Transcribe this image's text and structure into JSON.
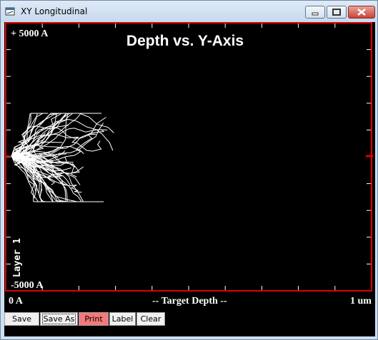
{
  "window": {
    "title": "XY Longitudinal",
    "icon": "app-window-icon",
    "controls": [
      "minimize-icon",
      "maximize-icon",
      "close-icon"
    ],
    "close_color": "#c94436"
  },
  "plot": {
    "title": "Depth vs. Y-Axis",
    "y_top_label": "+ 5000 A",
    "y_bottom_label": "-5000 A",
    "layer_label": "Layer 1",
    "frame_color": "#e00000",
    "trace_color": "#ffffff",
    "background": "#000000"
  },
  "status": {
    "left": "0 A",
    "center": "-- Target Depth --",
    "right": "1 um"
  },
  "toolbar": {
    "save": "Save",
    "save_as": "Save As",
    "print": "Print",
    "label": "Label",
    "clear": "Clear",
    "print_color": "#f47a7a"
  }
}
